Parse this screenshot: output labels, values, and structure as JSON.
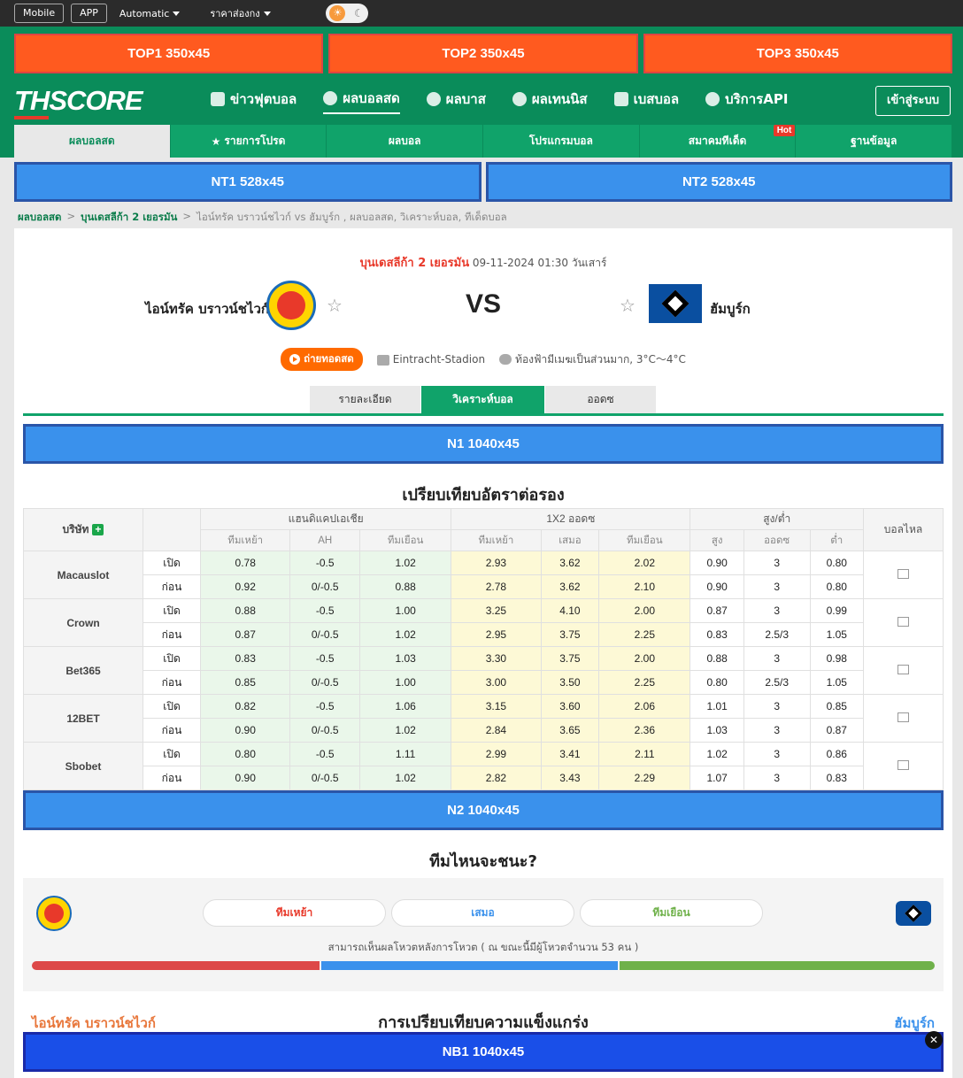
{
  "topbar": {
    "mobile": "Mobile",
    "app": "APP",
    "mode": "Automatic",
    "odds_type": "ราคาส่องกง"
  },
  "ads": {
    "top": [
      "TOP1 350x45",
      "TOP2 350x45",
      "TOP3 350x45"
    ],
    "nt": [
      "NT1 528x45",
      "NT2 528x45"
    ],
    "n1": "N1 1040x45",
    "n2": "N2 1040x45",
    "nb1": "NB1 1040x45"
  },
  "brand": {
    "th": "TH",
    "score": "SCORE"
  },
  "nav": {
    "items": [
      "ข่าวฟุตบอล",
      "ผลบอลสด",
      "ผลบาส",
      "ผลเทนนิส",
      "เบสบอล",
      "บริการAPI"
    ],
    "login": "เข้าสู่ระบบ"
  },
  "subnav": {
    "items": [
      "ผลบอลสด",
      "รายการโปรด",
      "ผลบอล",
      "โปรแกรมบอล",
      "สมาคมทีเด็ด",
      "ฐานข้อมูล"
    ],
    "hot": "Hot"
  },
  "breadcrumb": {
    "home": "ผลบอลสด",
    "league": "บุนเดสลีก้า 2 เยอรมัน",
    "current": "ไอน์ทรัค บราวน์ชไวก์ vs  ฮัมบูร์ก ,  ผลบอลสด,  วิเคราะห์บอล,  ทีเด็ดบอล"
  },
  "match": {
    "league": "บุนเดสลีก้า 2 เยอรมัน",
    "datetime": "09-11-2024 01:30 วันเสาร์",
    "home": "ไอน์ทรัค บราวน์ชไวก์",
    "away": "ฮัมบูร์ก",
    "vs": "VS",
    "live_label": "ถ่ายทอดสด",
    "stadium": "Eintracht-Stadion",
    "weather": "ท้องฟ้ามีเมฆเป็นส่วนมาก, 3°C～4°C"
  },
  "tabs": [
    "รายละเอียด",
    "วิเคราะห์บอล",
    "ออดซ"
  ],
  "odds": {
    "title": "เปรียบเทียบอัตราต่อรอง",
    "headers": {
      "company": "บริษัท",
      "ah": "แฮนดิแคปเอเชีย",
      "x12": "1X2 ออดซ",
      "ou": "สูง/ต่ำ",
      "run": "บอลไหล",
      "ah_sub": [
        "ทีมเหย้า",
        "AH",
        "ทีมเยือน"
      ],
      "x12_sub": [
        "ทีมเหย้า",
        "เสมอ",
        "ทีมเยือน"
      ],
      "ou_sub": [
        "สูง",
        "ออดซ",
        "ต่ำ"
      ]
    },
    "open_label": "เปิด",
    "before_label": "ก่อน",
    "rows": [
      {
        "company": "Macauslot",
        "open": [
          "0.78",
          "-0.5",
          "1.02",
          "2.93",
          "3.62",
          "2.02",
          "0.90",
          "3",
          "0.80"
        ],
        "before": [
          "0.92",
          "0/-0.5",
          "0.88",
          "2.78",
          "3.62",
          "2.10",
          "0.90",
          "3",
          "0.80"
        ]
      },
      {
        "company": "Crown",
        "open": [
          "0.88",
          "-0.5",
          "1.00",
          "3.25",
          "4.10",
          "2.00",
          "0.87",
          "3",
          "0.99"
        ],
        "before": [
          "0.87",
          "0/-0.5",
          "1.02",
          "2.95",
          "3.75",
          "2.25",
          "0.83",
          "2.5/3",
          "1.05"
        ]
      },
      {
        "company": "Bet365",
        "open": [
          "0.83",
          "-0.5",
          "1.03",
          "3.30",
          "3.75",
          "2.00",
          "0.88",
          "3",
          "0.98"
        ],
        "before": [
          "0.85",
          "0/-0.5",
          "1.00",
          "3.00",
          "3.50",
          "2.25",
          "0.80",
          "2.5/3",
          "1.05"
        ]
      },
      {
        "company": "12BET",
        "open": [
          "0.82",
          "-0.5",
          "1.06",
          "3.15",
          "3.60",
          "2.06",
          "1.01",
          "3",
          "0.85"
        ],
        "before": [
          "0.90",
          "0/-0.5",
          "1.02",
          "2.84",
          "3.65",
          "2.36",
          "1.03",
          "3",
          "0.87"
        ]
      },
      {
        "company": "Sbobet",
        "open": [
          "0.80",
          "-0.5",
          "1.11",
          "2.99",
          "3.41",
          "2.11",
          "1.02",
          "3",
          "0.86"
        ],
        "before": [
          "0.90",
          "0/-0.5",
          "1.02",
          "2.82",
          "3.43",
          "2.29",
          "1.07",
          "3",
          "0.83"
        ]
      }
    ]
  },
  "vote": {
    "title": "ทีมไหนจะชนะ?",
    "home": "ทีมเหย้า",
    "draw": "เสมอ",
    "away": "ทีมเยือน",
    "note": "สามารถเห็นผลโหวตหลังการโหวต ( ณ ขณะนี้มีผู้โหวตจำนวน 53 คน )",
    "share": [
      0.32,
      0.33,
      0.35
    ],
    "colors": {
      "home": "#dd4848",
      "draw": "#3a91ec",
      "away": "#6fb14a"
    }
  },
  "strength": {
    "title": "การเปรียบเทียบความแข็งแกร่ง",
    "home": "ไอน์ทรัค บราวน์ชไวก์",
    "away": "ฮัมบูร์ก"
  },
  "colors": {
    "brand": "#0a8c5a",
    "accent": "#e8392a",
    "live": "#ff6a00"
  }
}
